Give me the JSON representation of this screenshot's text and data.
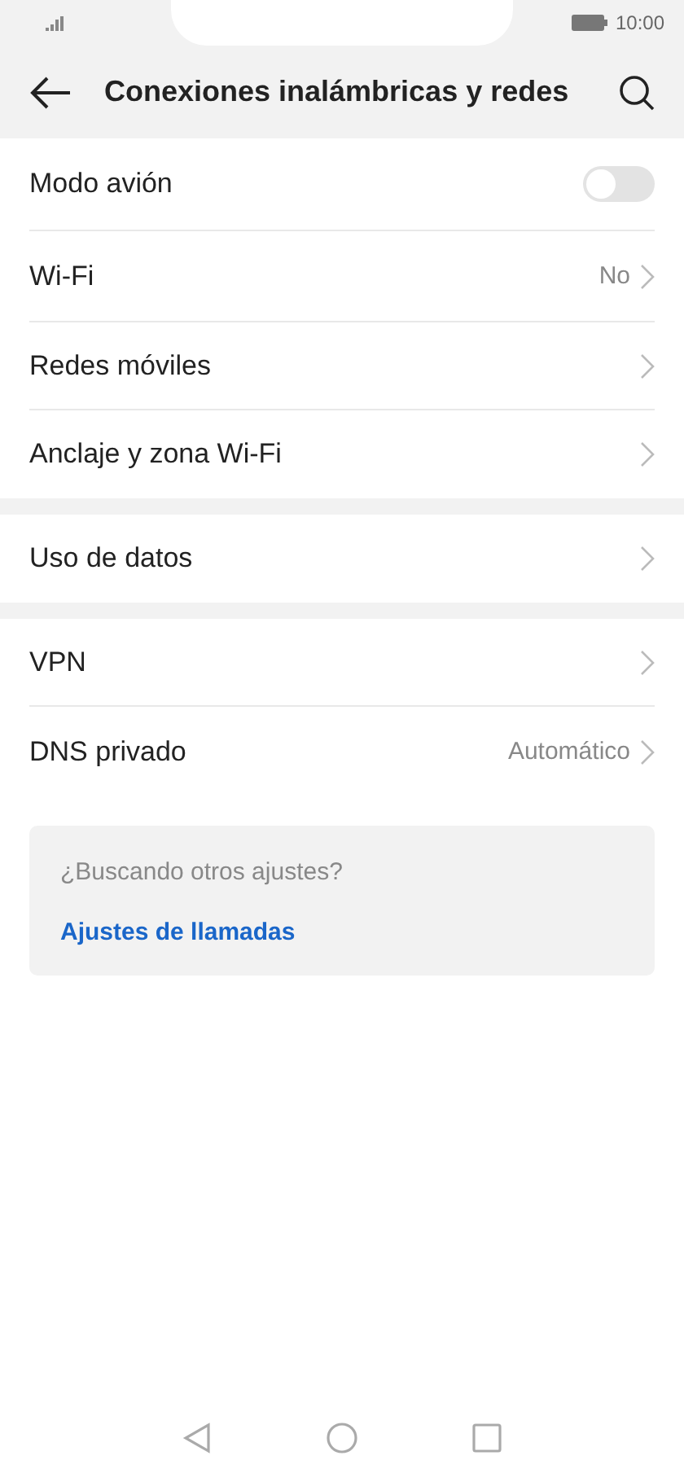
{
  "status_bar": {
    "time": "10:00"
  },
  "header": {
    "title": "Conexiones inalámbricas y redes"
  },
  "sections": [
    {
      "items": [
        {
          "kind": "toggle",
          "label": "Modo avión",
          "on": false
        },
        {
          "kind": "link",
          "label": "Wi-Fi",
          "value": "No"
        },
        {
          "kind": "link",
          "label": "Redes móviles"
        },
        {
          "kind": "link",
          "label": "Anclaje y zona Wi-Fi"
        }
      ]
    },
    {
      "items": [
        {
          "kind": "link",
          "label": "Uso de datos"
        }
      ]
    },
    {
      "items": [
        {
          "kind": "link",
          "label": "VPN"
        },
        {
          "kind": "link",
          "label": "DNS privado",
          "value": "Automático"
        }
      ]
    }
  ],
  "suggestions": {
    "title": "¿Buscando otros ajustes?",
    "links": [
      "Ajustes de llamadas"
    ]
  }
}
